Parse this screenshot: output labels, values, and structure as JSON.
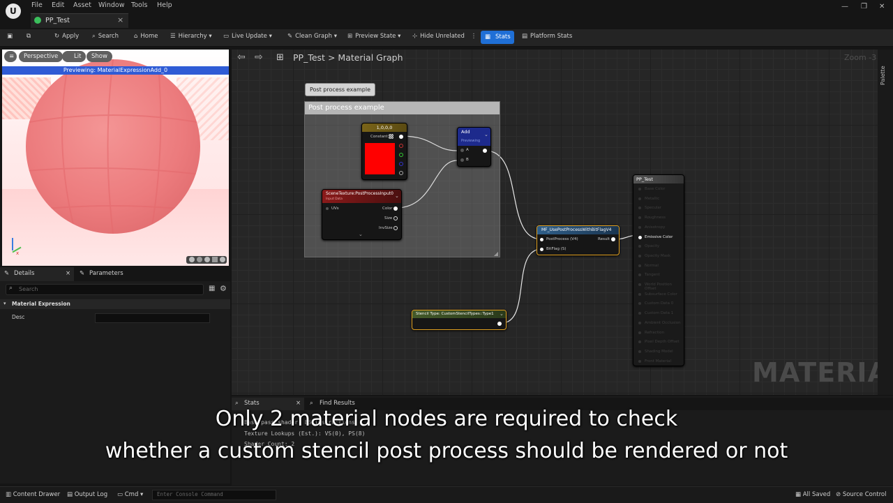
{
  "menu": [
    "File",
    "Edit",
    "Asset",
    "Window",
    "Tools",
    "Help"
  ],
  "tab": {
    "label": "PP_Test"
  },
  "toolbar": {
    "apply": "Apply",
    "search": "Search",
    "home": "Home",
    "hierarchy": "Hierarchy",
    "live_update": "Live Update",
    "clean_graph": "Clean Graph",
    "preview_state": "Preview State",
    "hide_unrelated": "Hide Unrelated",
    "stats": "Stats",
    "platform_stats": "Platform Stats"
  },
  "viewport": {
    "perspective": "Perspective",
    "lit": "Lit",
    "show": "Show",
    "banner": "Previewing: MaterialExpressionAdd_0"
  },
  "details": {
    "tab_details": "Details",
    "tab_parameters": "Parameters",
    "search_placeholder": "Search",
    "section": "Material Expression",
    "desc_label": "Desc"
  },
  "graph": {
    "breadcrumb_root": "PP_Test",
    "breadcrumb_sep": ">",
    "breadcrumb_page": "Material Graph",
    "zoom": "Zoom -3",
    "palette": "Palette",
    "watermark": "MATERIAL"
  },
  "comment": {
    "bubble": "Post process example",
    "title": "Post process example"
  },
  "nodes": {
    "constant": {
      "title": "1,0,0,0",
      "pin": "Constant",
      "color": "#ff0000"
    },
    "add": {
      "title": "Add",
      "subtitle": "Previewing",
      "pin_a": "A",
      "pin_b": "B"
    },
    "scene_texture": {
      "title": "SceneTexture:PostProcessInput0",
      "subtitle": "Input Data",
      "pin_uvs": "UVs",
      "pin_color": "Color",
      "pin_size": "Size",
      "pin_invsize": "InvSize"
    },
    "mf": {
      "title": "MF_UsePostProcessWithBitFlagV4",
      "pin_pp": "PostProcess (V4)",
      "pin_bitflag": "BitFlag (S)",
      "pin_result": "Result"
    },
    "stencil": {
      "title": "Stencil Type: CustomStencilTypes::Type1"
    },
    "output": {
      "title": "PP_Test",
      "pins": [
        "Base Color",
        "Metallic",
        "Specular",
        "Roughness",
        "Anisotropy",
        "Emissive Color",
        "Opacity",
        "Opacity Mask",
        "Normal",
        "Tangent",
        "World Position Offset",
        "Subsurface Color",
        "Custom Data 0",
        "Custom Data 1",
        "Ambient Occlusion",
        "Refraction",
        "Pixel Depth Offset",
        "Shading Model",
        "Front Material"
      ],
      "active": "Emissive Color"
    }
  },
  "stats_panel": {
    "tab_stats": "Stats",
    "tab_find": "Find Results",
    "lines": [
      "Base pass shader: 85 instructions",
      "Texture Lookups (Est.): VS(0), PS(8)",
      "Shader Count: 2"
    ]
  },
  "subtitle": {
    "line1": "Only 2 material nodes are required to check",
    "line2": "whether a custom stencil post process should be rendered or not"
  },
  "statusbar": {
    "content_drawer": "Content Drawer",
    "output_log": "Output Log",
    "cmd": "Cmd",
    "console_placeholder": "Enter Console Command",
    "all_saved": "All Saved",
    "source_control": "Source Control"
  }
}
